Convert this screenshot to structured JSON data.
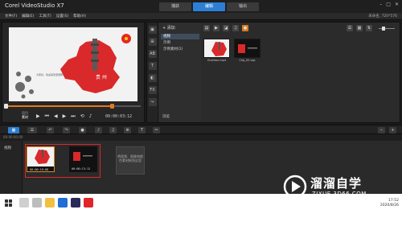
{
  "app": {
    "title": "Corel VideoStudio X7"
  },
  "steps": [
    {
      "label": "捕获",
      "active": false
    },
    {
      "label": "编辑",
      "active": true
    },
    {
      "label": "输出",
      "active": false
    }
  ],
  "window_controls": [
    "–",
    "□",
    "✕"
  ],
  "menu": [
    "文件(F)",
    "编辑(E)",
    "工具(T)",
    "设置(S)",
    "帮助(H)"
  ],
  "project_size": "未命名, 720*576",
  "player": {
    "modes": {
      "project": "项目",
      "clip": "素材"
    },
    "timecode": "00:00:03:12",
    "progress_fraction": 0.78,
    "preview_city": "贵 州",
    "preview_caption": "大家好，欢迎来到溜溜网..."
  },
  "library": {
    "add_label": "+ 添加",
    "tree": [
      {
        "label": "视频",
        "selected": true
      },
      {
        "label": "示例",
        "selected": false
      },
      {
        "label": "示例素材(2)",
        "selected": false
      }
    ],
    "browse_label": "浏览",
    "thumbs": [
      {
        "label": "Guizhou.mp4"
      },
      {
        "label": "Clip_02.vsp"
      }
    ]
  },
  "timeline": {
    "ruler_label": "00:00:00:00",
    "track_name": "视频",
    "clips": [
      {
        "timecode": "00:00:16:08",
        "selected": true
      },
      {
        "timecode": "00:00:13:12",
        "selected": false
      }
    ],
    "drop_hint": "将视频、图像和颜色素材拖到这里"
  },
  "watermark": {
    "title": "溜溜自学",
    "url": "ZIXUE.3D66.COM"
  },
  "taskbar": {
    "time": "17:52",
    "date": "2020/8/26"
  },
  "colors": {
    "accent": "#2d7fd6",
    "timeline_progress": "#e07a1f",
    "selection": "#e0262b",
    "map_red": "#d9292a"
  }
}
